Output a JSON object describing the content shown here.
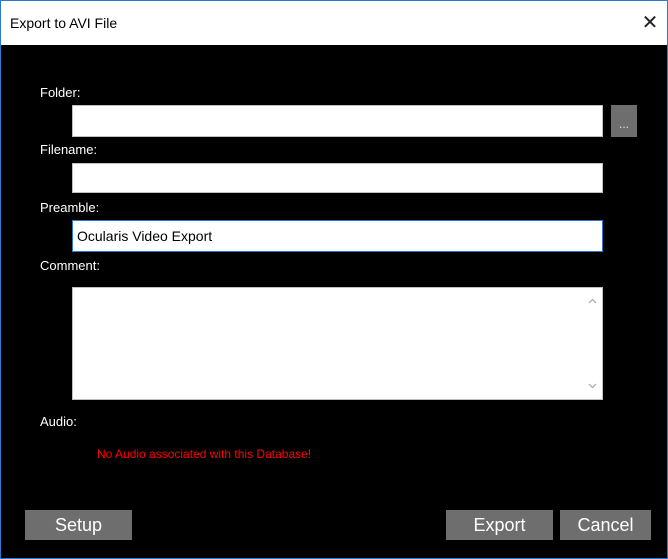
{
  "window": {
    "title": "Export to AVI File",
    "close_label": "✕"
  },
  "form": {
    "folder": {
      "label": "Folder:",
      "value": "",
      "browse_label": "..."
    },
    "filename": {
      "label": "Filename:",
      "value": ""
    },
    "preamble": {
      "label": "Preamble:",
      "value": "Ocularis Video Export"
    },
    "comment": {
      "label": "Comment:",
      "value": ""
    },
    "audio": {
      "label": "Audio:",
      "message": "No Audio associated with this Database!"
    }
  },
  "buttons": {
    "setup": "Setup",
    "export": "Export",
    "cancel": "Cancel"
  },
  "colors": {
    "accent": "#2b78d0",
    "error": "#ff0000",
    "button": "#6e6e6e",
    "background": "#000000"
  },
  "icons": {
    "close": "close-icon",
    "scroll_up": "chevron-up-icon",
    "scroll_down": "chevron-down-icon"
  }
}
